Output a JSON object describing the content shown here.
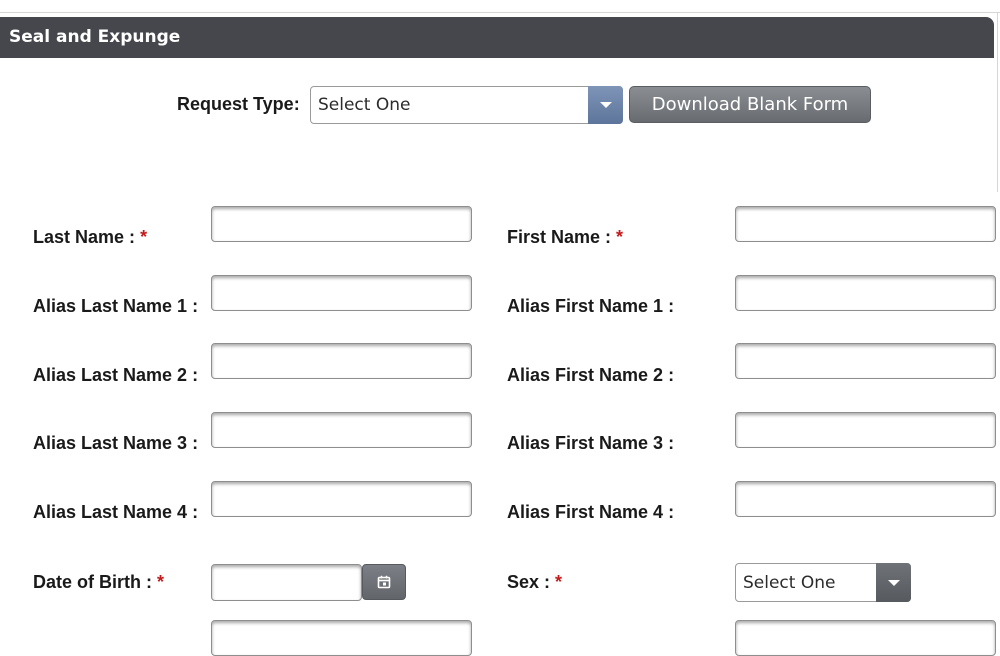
{
  "header": {
    "title": "Seal and Expunge"
  },
  "request": {
    "label": "Request Type:",
    "selected": "Select One",
    "download_label": "Download Blank Form"
  },
  "form": {
    "required_mark": "*",
    "last_name_label": "Last Name :",
    "first_name_label": "First Name :",
    "alias_last_1_label": "Alias Last Name 1 :",
    "alias_first_1_label": "Alias First Name 1 :",
    "alias_last_2_label": "Alias Last Name 2 :",
    "alias_first_2_label": "Alias First Name 2 :",
    "alias_last_3_label": "Alias Last Name 3 :",
    "alias_first_3_label": "Alias First Name 3 :",
    "alias_last_4_label": "Alias Last Name 4 :",
    "alias_first_4_label": "Alias First Name 4 :",
    "dob_label": "Date of Birth :",
    "sex_label": "Sex :",
    "sex_selected": "Select One"
  },
  "icons": {
    "calendar": "calendar-icon",
    "dropdown": "chevron-down-icon"
  },
  "colors": {
    "header_bg": "#45474c",
    "required": "#c41a1a",
    "select_arrow": "#5d759a"
  }
}
